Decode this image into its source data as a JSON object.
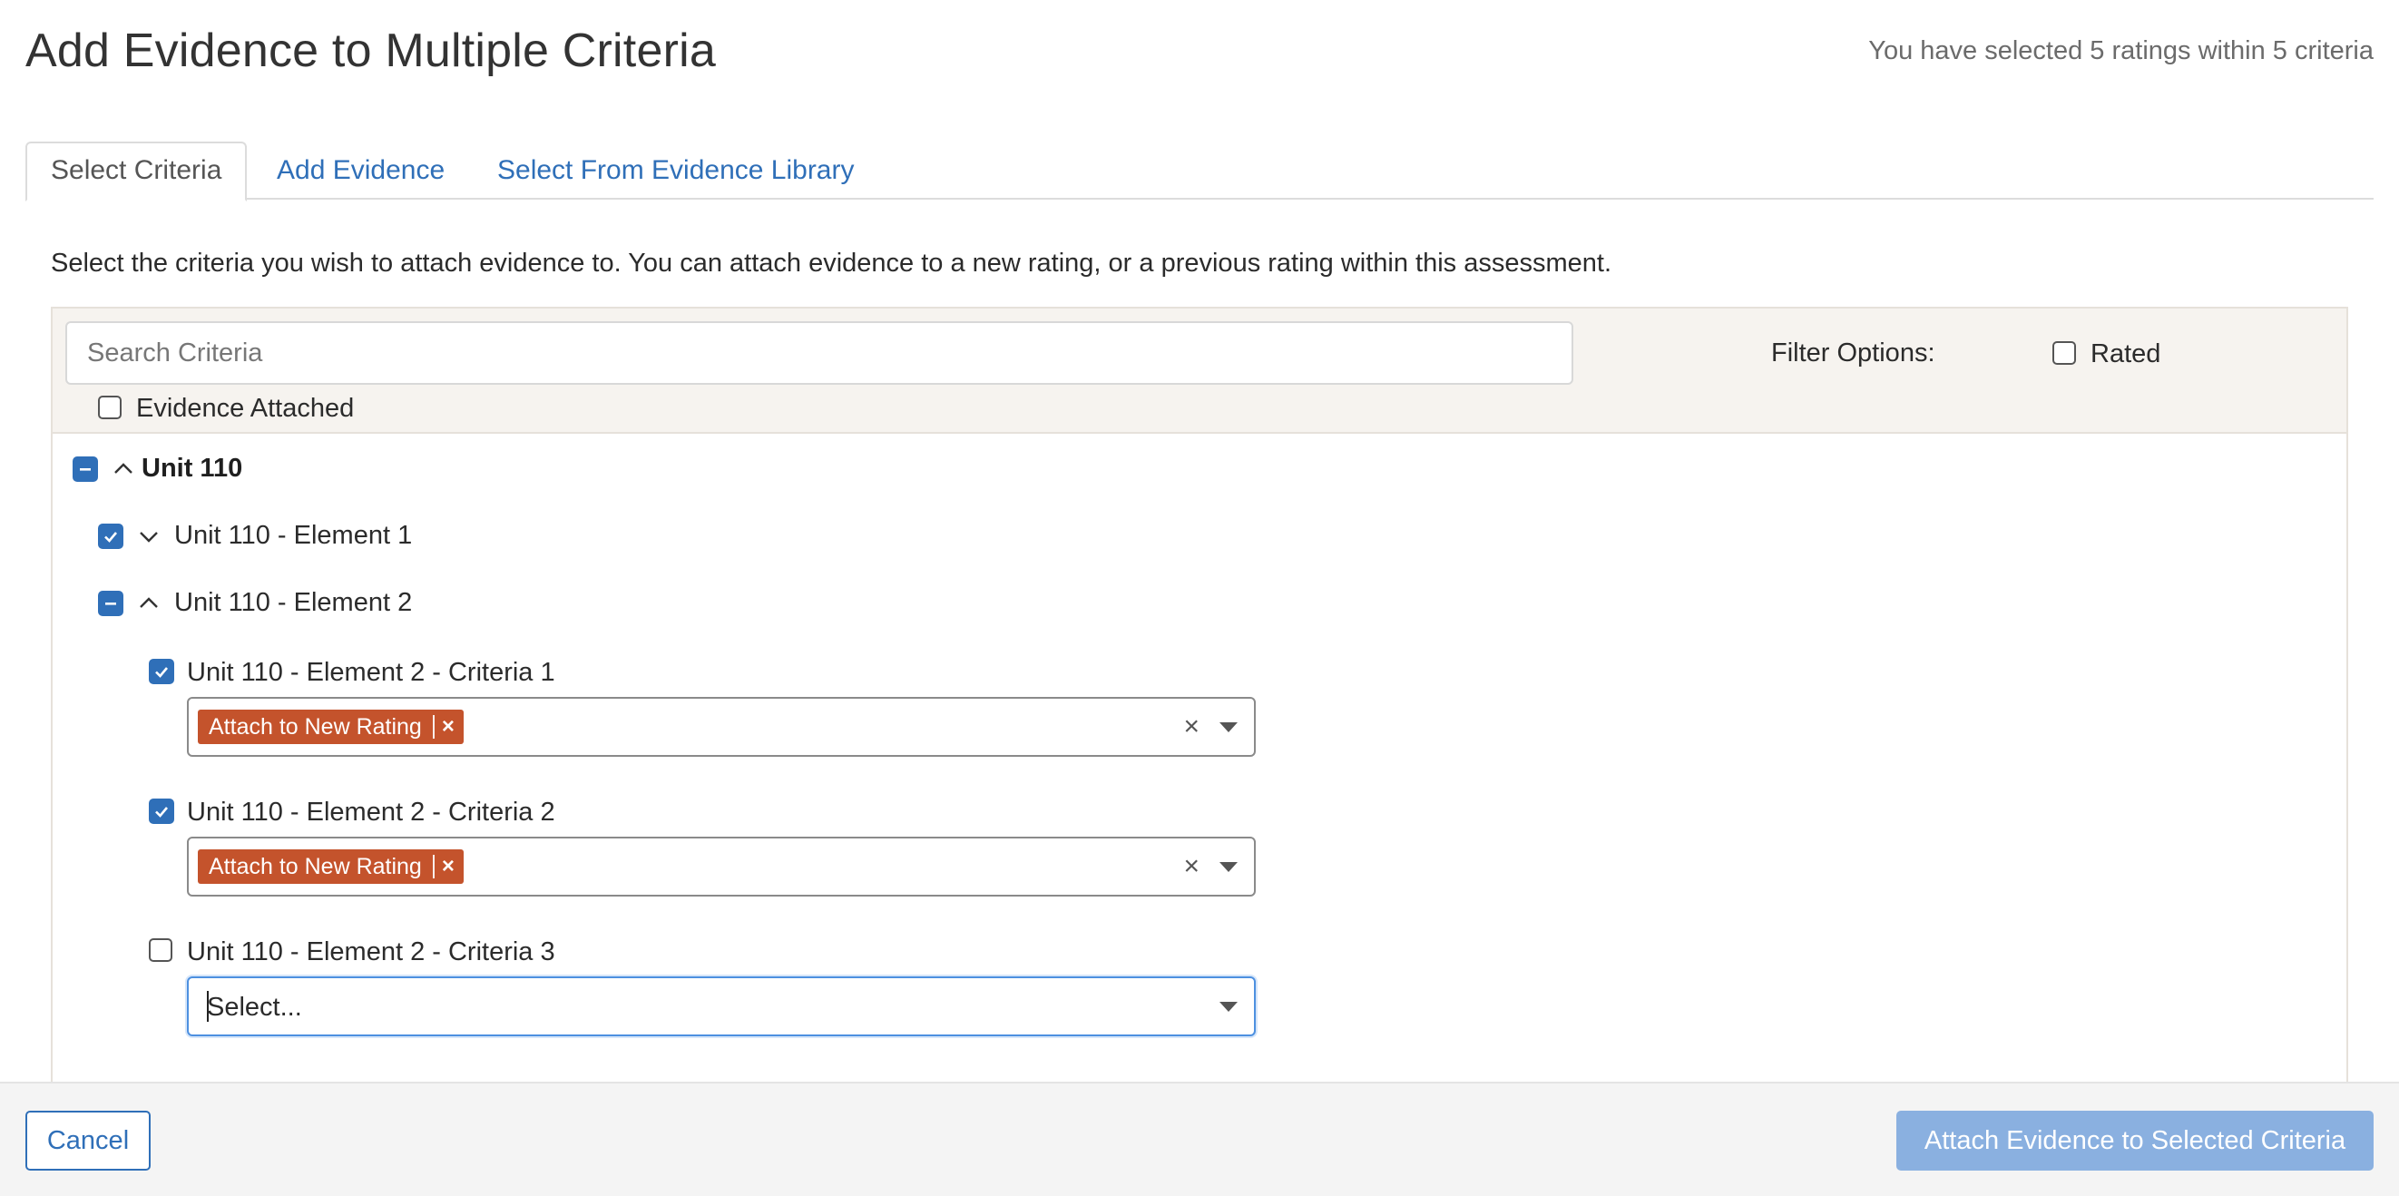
{
  "header": {
    "title": "Add Evidence to Multiple Criteria",
    "selection_summary": "You have selected 5 ratings within 5 criteria"
  },
  "tabs": [
    {
      "label": "Select Criteria",
      "active": true
    },
    {
      "label": "Add Evidence",
      "active": false
    },
    {
      "label": "Select From Evidence Library",
      "active": false
    }
  ],
  "instructions": "Select the criteria you wish to attach evidence to. You can attach evidence to a new rating, or a previous rating within this assessment.",
  "filters": {
    "search_placeholder": "Search Criteria",
    "filter_options_label": "Filter Options:",
    "rated_label": "Rated",
    "rated_checked": false,
    "evidence_attached_label": "Evidence Attached",
    "evidence_attached_checked": false
  },
  "tree": {
    "unit": {
      "label": "Unit 110",
      "state": "indeterminate",
      "expanded": true
    },
    "elements": [
      {
        "label": "Unit 110 - Element 1",
        "state": "checked",
        "expanded": false
      },
      {
        "label": "Unit 110 - Element 2",
        "state": "indeterminate",
        "expanded": true
      }
    ],
    "criteria": [
      {
        "label": "Unit 110 - Element 2 - Criteria 1",
        "checked": true,
        "chip": "Attach to New Rating",
        "chip_remove": "×",
        "clear": "×"
      },
      {
        "label": "Unit 110 - Element 2 - Criteria 2",
        "checked": true,
        "chip": "Attach to New Rating",
        "chip_remove": "×",
        "clear": "×"
      },
      {
        "label": "Unit 110 - Element 2 - Criteria 3",
        "checked": false,
        "select_placeholder": "Select..."
      }
    ]
  },
  "footer": {
    "cancel_label": "Cancel",
    "attach_label": "Attach Evidence to Selected Criteria"
  },
  "colors": {
    "accent": "#2f6fb8",
    "chip": "#c4532c",
    "filter_bar": "#f6f3ef",
    "attach_button_disabled": "#8ab0e0"
  }
}
